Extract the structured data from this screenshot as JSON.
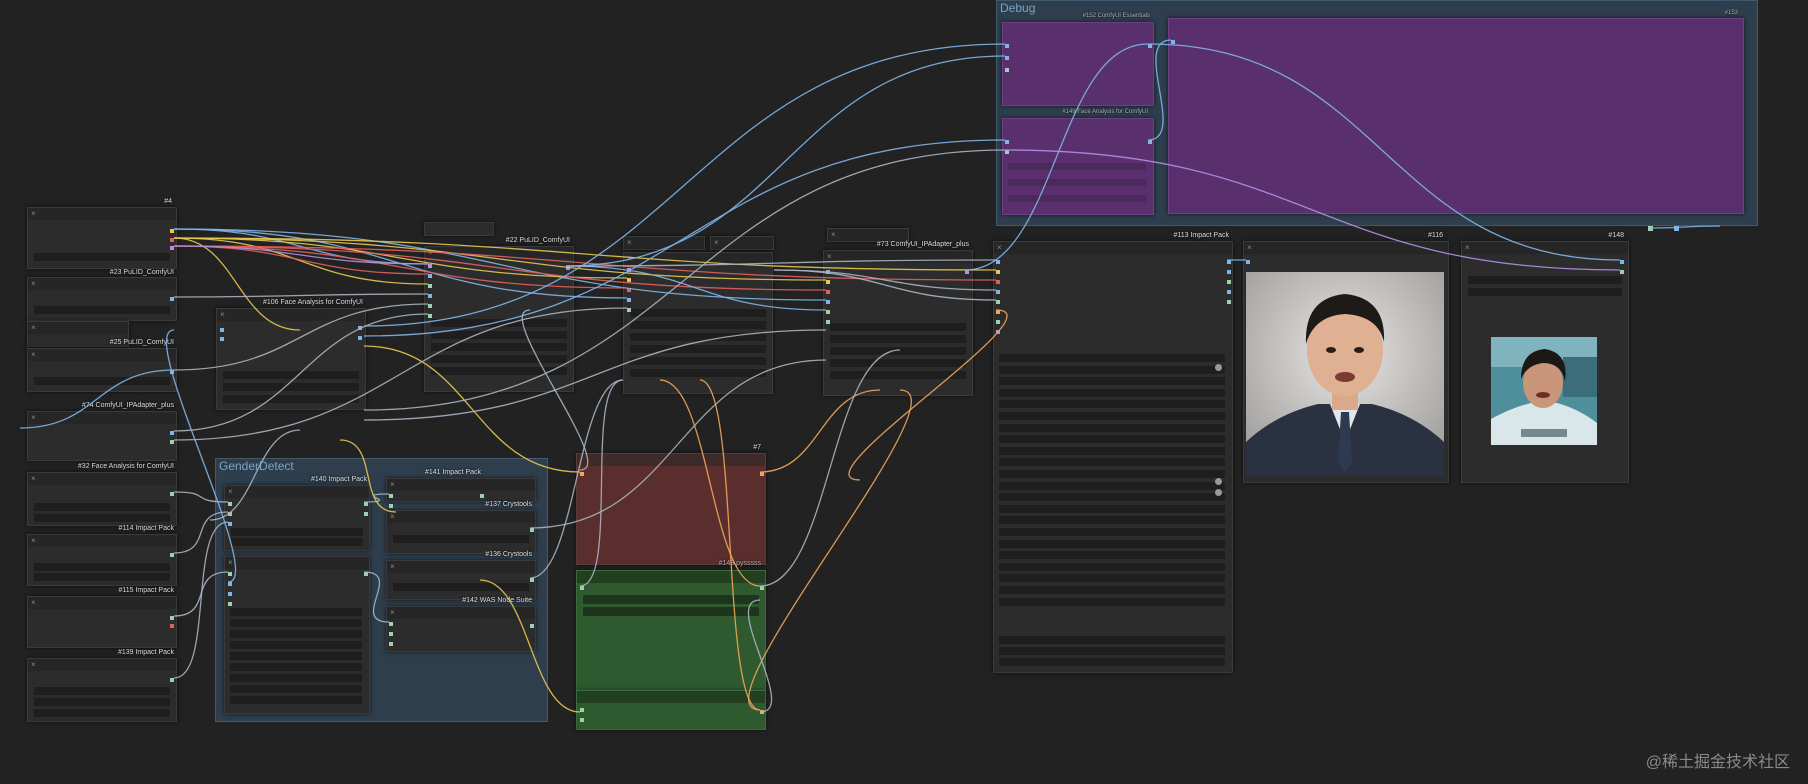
{
  "colors": {
    "wire_blue": "#7fb5e8",
    "wire_yellow": "#e6c84f",
    "wire_orange": "#f0a65a",
    "wire_red": "#e06060",
    "wire_purple": "#b48fe6",
    "wire_grey": "#a8b4c2",
    "node_red": "#5a2e2c",
    "node_green": "#2f5a30",
    "node_purple": "#5a2f6e",
    "group_blue": "#2e3e4c"
  },
  "groups": {
    "debug": {
      "title": "Debug"
    },
    "gender": {
      "title": "GenderDetect"
    }
  },
  "nodes": {
    "n4": "#4",
    "n23": "#23 PuLID_ComfyUI",
    "n25": "#25 PuLID_ComfyUI",
    "n74": "#74 ComfyUI_IPAdapter_plus",
    "n32": "#32 Face Analysis for ComfyUI",
    "n114": "#114 Impact Pack",
    "n115": "#115 Impact Pack",
    "n139": "#139 Impact Pack",
    "n106": "#106 Face Analysis for ComfyUI",
    "n22": "#22 PuLID_ComfyUI",
    "n73": "#73 ComfyUI_IPAdapter_plus",
    "n113": "#113 Impact Pack",
    "n116": "#116",
    "n148": "#148",
    "n140": "#140 Impact Pack",
    "n141": "#141 Impact Pack",
    "n137": "#137 Crystools",
    "n136": "#136 Crystools",
    "n142": "#142 WAS Node Suite",
    "n7": "#7",
    "n143": "#143 pysssss",
    "n152": "#152 ComfyUI Essentials",
    "n149": "#149 Face Analysis for ComfyUI",
    "n153": "#153"
  },
  "icons": [
    "close-icon",
    "toggle-dot-icon"
  ],
  "watermark": "@稀土掘金技术社区"
}
